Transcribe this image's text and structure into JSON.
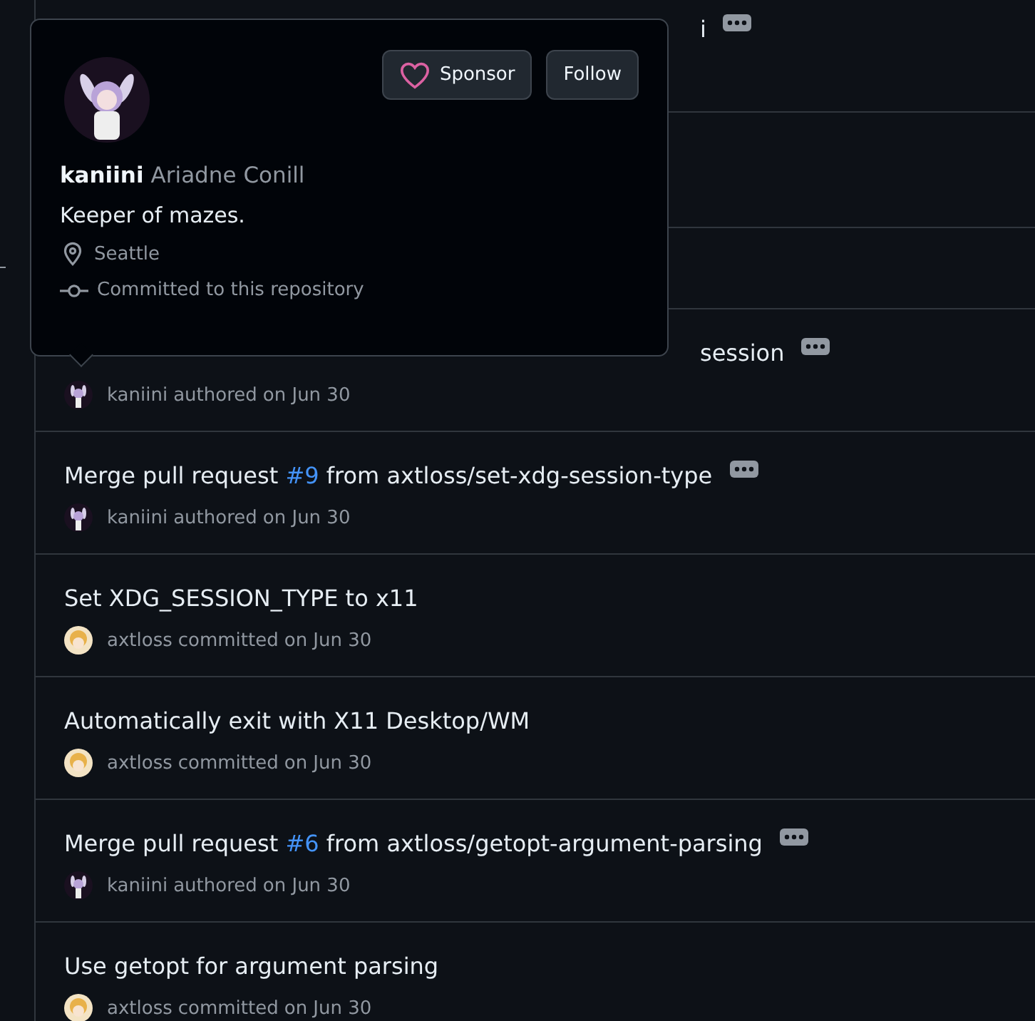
{
  "commits": [
    {
      "kind": "covered",
      "fragment": "i",
      "menu": true
    },
    {
      "kind": "covered",
      "fragment": "session",
      "menu": true,
      "meta": {
        "kind": "bunny",
        "author": "kaniini",
        "action": "authored",
        "date": "on Jun 30"
      }
    },
    {
      "kind": "pr",
      "before": "Merge pull request ",
      "link": "#9",
      "after": " from axtloss/set-xdg-session-type",
      "menu": true,
      "meta": {
        "kind": "bunny",
        "author": "kaniini",
        "action": "authored",
        "date": "on Jun 30"
      }
    },
    {
      "kind": "plain",
      "title": "Set XDG_SESSION_TYPE to x11",
      "menu": false,
      "meta": {
        "kind": "blonde",
        "author": "axtloss",
        "action": "committed",
        "date": "on Jun 30"
      }
    },
    {
      "kind": "plain",
      "title": "Automatically exit with X11 Desktop/WM",
      "menu": false,
      "meta": {
        "kind": "blonde",
        "author": "axtloss",
        "action": "committed",
        "date": "on Jun 30"
      }
    },
    {
      "kind": "pr",
      "before": "Merge pull request ",
      "link": "#6",
      "after": " from axtloss/getopt-argument-parsing",
      "menu": true,
      "meta": {
        "kind": "bunny",
        "author": "kaniini",
        "action": "authored",
        "date": "on Jun 30"
      }
    },
    {
      "kind": "plain",
      "title": "Use getopt for argument parsing",
      "menu": false,
      "meta": {
        "kind": "blonde",
        "author": "axtloss",
        "action": "committed",
        "date": "on Jun 30"
      }
    }
  ],
  "hovercard": {
    "login": "kaniini",
    "name": "Ariadne Conill",
    "bio": "Keeper of mazes.",
    "location": "Seattle",
    "note": "Committed to this repository",
    "buttons": [
      {
        "kind": "sponsor",
        "label": "Sponsor"
      },
      {
        "kind": "follow",
        "label": "Follow"
      }
    ]
  }
}
